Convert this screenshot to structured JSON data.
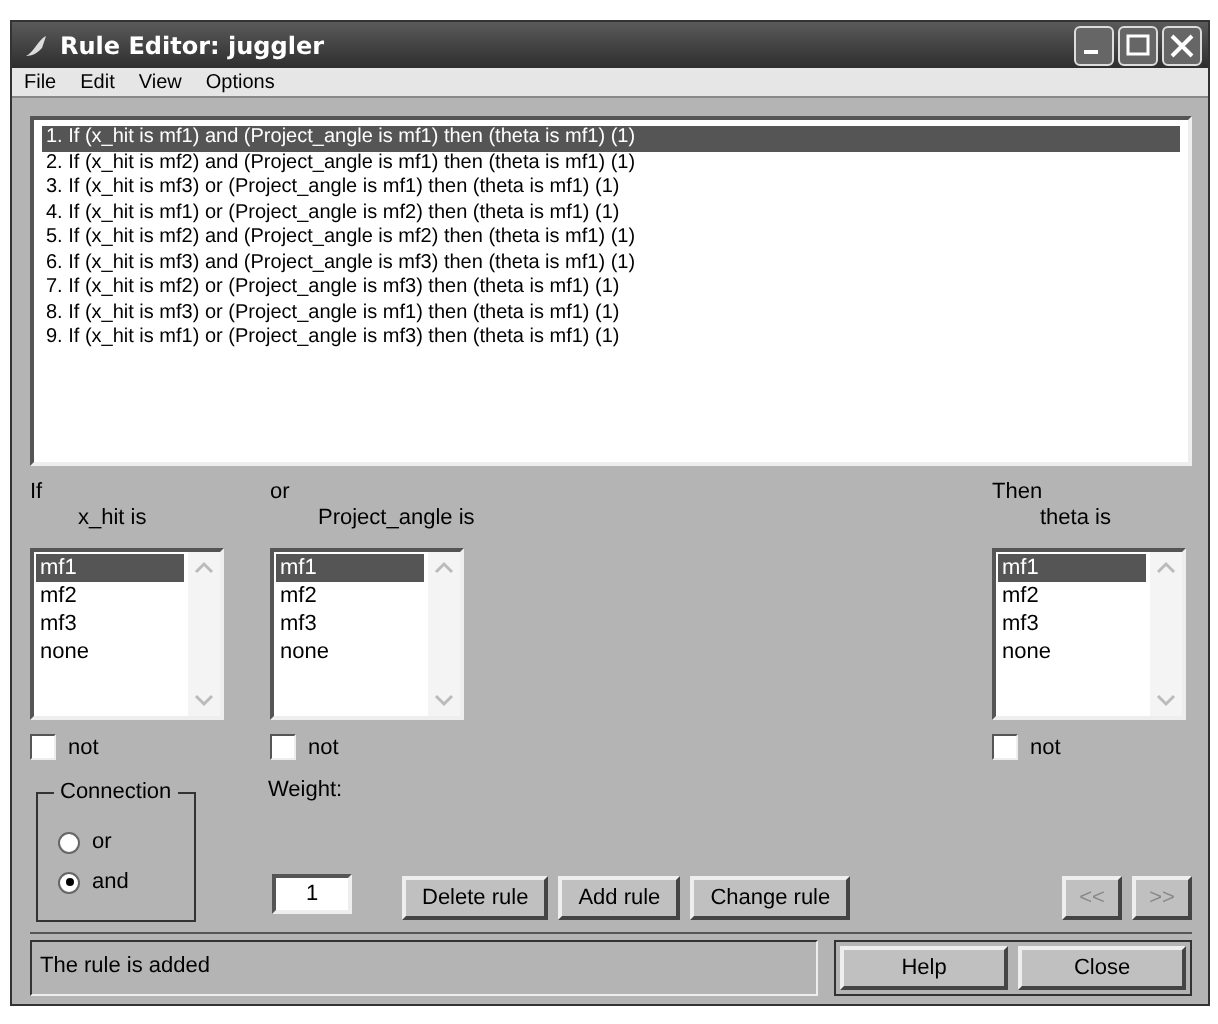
{
  "window": {
    "title": "Rule Editor: juggler"
  },
  "menu": [
    "File",
    "Edit",
    "View",
    "Options"
  ],
  "rules": [
    {
      "text": "1. If (x_hit is mf1) and (Project_angle is mf1) then (theta is mf1) (1)",
      "selected": true
    },
    {
      "text": "2. If (x_hit is mf2) and (Project_angle is mf1) then (theta is mf1) (1)",
      "selected": false
    },
    {
      "text": "3. If (x_hit is mf3) or (Project_angle is mf1) then (theta is mf1) (1)",
      "selected": false
    },
    {
      "text": "4. If (x_hit is mf1) or (Project_angle is mf2) then (theta is mf1) (1)",
      "selected": false
    },
    {
      "text": "5. If (x_hit is mf2) and (Project_angle is mf2) then (theta is mf1) (1)",
      "selected": false
    },
    {
      "text": "6. If (x_hit is mf3) and (Project_angle is mf3) then (theta is mf1) (1)",
      "selected": false
    },
    {
      "text": "7. If (x_hit is mf2) or (Project_angle is mf3) then (theta is mf1) (1)",
      "selected": false
    },
    {
      "text": "8. If (x_hit is mf3) or (Project_angle is mf1) then (theta is mf1) (1)",
      "selected": false
    },
    {
      "text": "9. If (x_hit is mf1) or (Project_angle is mf3) then (theta is mf1) (1)",
      "selected": false
    }
  ],
  "variables": [
    {
      "kind": "input",
      "prefix": "If",
      "label": "x_hit is",
      "not_label": "not",
      "not_checked": false,
      "items": [
        {
          "label": "mf1",
          "selected": true
        },
        {
          "label": "mf2",
          "selected": false
        },
        {
          "label": "mf3",
          "selected": false
        },
        {
          "label": "none",
          "selected": false
        }
      ]
    },
    {
      "kind": "input",
      "prefix": "or",
      "label": "Project_angle is",
      "not_label": "not",
      "not_checked": false,
      "items": [
        {
          "label": "mf1",
          "selected": true
        },
        {
          "label": "mf2",
          "selected": false
        },
        {
          "label": "mf3",
          "selected": false
        },
        {
          "label": "none",
          "selected": false
        }
      ]
    },
    {
      "kind": "output",
      "prefix": "Then",
      "label": "theta is",
      "not_label": "not",
      "not_checked": false,
      "items": [
        {
          "label": "mf1",
          "selected": true
        },
        {
          "label": "mf2",
          "selected": false
        },
        {
          "label": "mf3",
          "selected": false
        },
        {
          "label": "none",
          "selected": false
        }
      ]
    }
  ],
  "connection": {
    "title": "Connection",
    "options": [
      {
        "label": "or",
        "selected": false
      },
      {
        "label": "and",
        "selected": true
      }
    ]
  },
  "weight": {
    "label": "Weight:",
    "value": "1"
  },
  "rule_buttons": [
    {
      "label": "Delete rule",
      "disabled": false
    },
    {
      "label": "Add rule",
      "disabled": false
    },
    {
      "label": "Change rule",
      "disabled": false
    }
  ],
  "nav_buttons": [
    {
      "label": "<<",
      "disabled": true
    },
    {
      "label": ">>",
      "disabled": true
    }
  ],
  "status": "The rule is added",
  "footer_buttons": [
    {
      "label": "Help",
      "disabled": false
    },
    {
      "label": "Close",
      "disabled": false
    }
  ]
}
